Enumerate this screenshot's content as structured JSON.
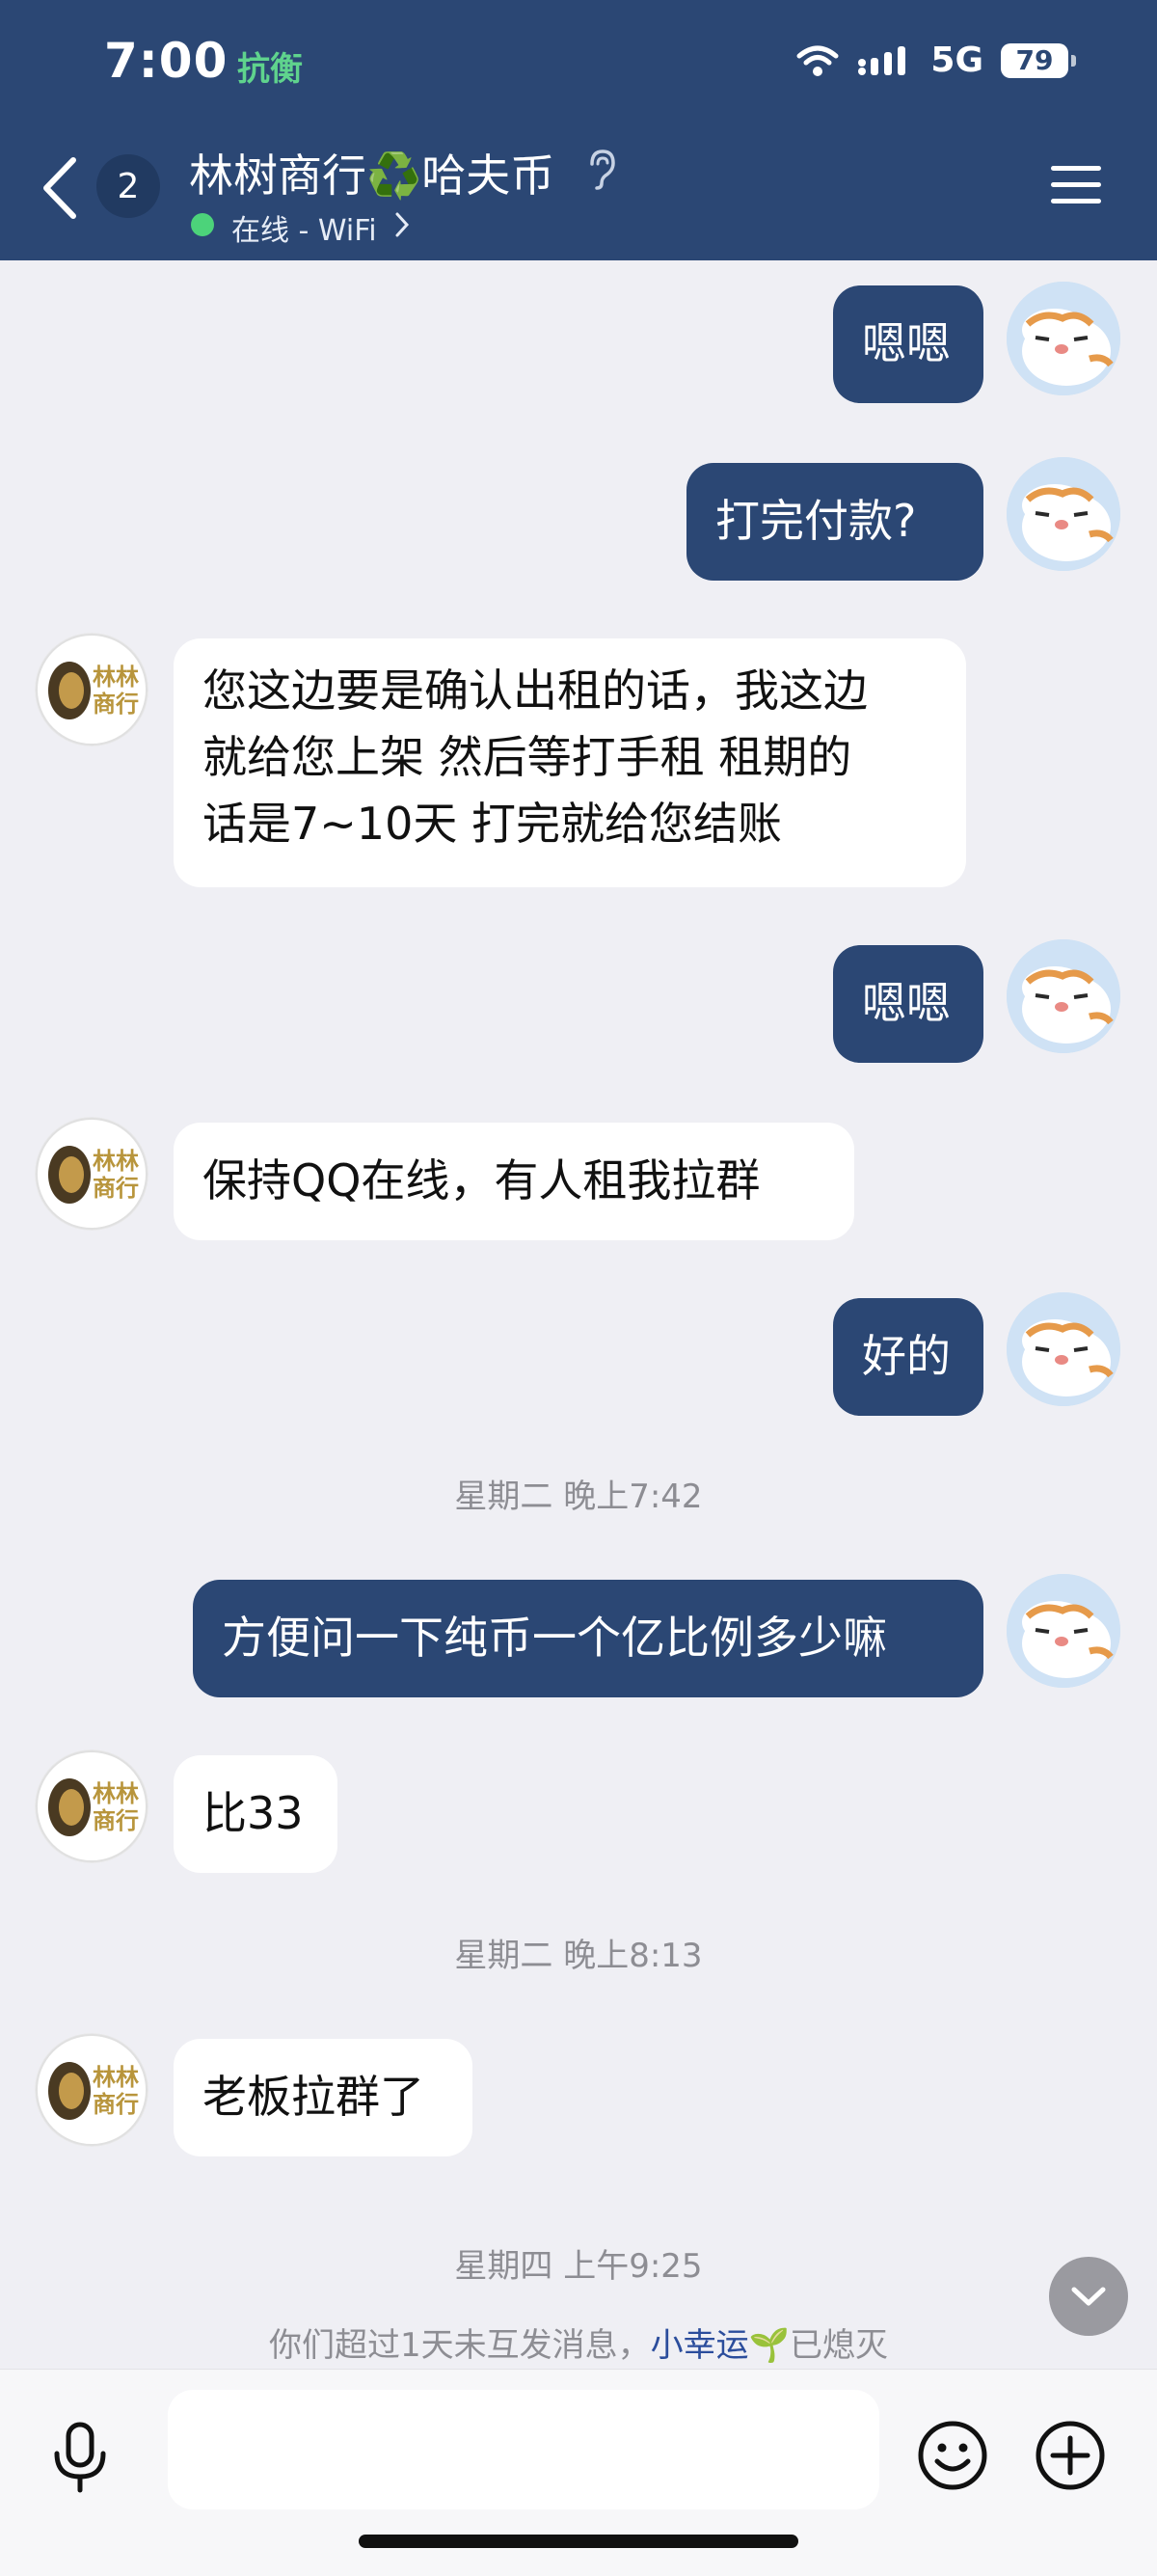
{
  "status_bar": {
    "time": "7:00",
    "app_name": "抗衡",
    "network": "5G",
    "battery": "79"
  },
  "header": {
    "unread_count": "2",
    "title": "林树商行♻️哈夫币",
    "status": "在线 - WiFi"
  },
  "messages": [
    {
      "side": "me",
      "text": "嗯嗯"
    },
    {
      "side": "me",
      "text": "打完付款?"
    },
    {
      "side": "them",
      "text": "您这边要是确认出租的话，我这边\n就给您上架 然后等打手租 租期的\n话是7~10天 打完就给您结账"
    },
    {
      "side": "me",
      "text": "嗯嗯"
    },
    {
      "side": "them",
      "text": "保持QQ在线，有人租我拉群"
    },
    {
      "side": "me",
      "text": "好的"
    },
    {
      "time": "星期二 晚上7:42"
    },
    {
      "side": "me",
      "text": "方便问一下纯币一个亿比例多少嘛"
    },
    {
      "side": "them",
      "text": "比33"
    },
    {
      "time": "星期二 晚上8:13"
    },
    {
      "side": "them",
      "text": "老板拉群了"
    },
    {
      "time": "星期四 上午9:25"
    }
  ],
  "notice": {
    "prefix": "你们超过1天未互发消息，",
    "link": "小幸运🌱",
    "suffix": "已熄灭"
  },
  "avatars": {
    "lion_text": "林林商行"
  },
  "colors": {
    "header_bg": "#2b4774",
    "my_bubble": "#2b4774",
    "their_bubble": "#ffffff",
    "online": "#4cd37a"
  }
}
